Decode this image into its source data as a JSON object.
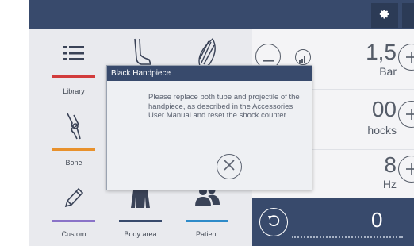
{
  "header": {
    "settings_icon": "gear-icon"
  },
  "tiles": {
    "library": {
      "label": "Library",
      "icon": "list-icon",
      "accent": "#d23c3c"
    },
    "bone": {
      "label": "Bone",
      "icon": "knee-joint-icon",
      "accent": "#e8912c"
    },
    "custom": {
      "label": "Custom",
      "icon": "pencil-icon",
      "accent": "#8a73c8"
    },
    "body_area": {
      "label": "Body area",
      "icon": "torso-icon",
      "accent": "#384a6c"
    },
    "patient": {
      "label": "Patient",
      "icon": "patients-icon",
      "accent": "#2e8bc9"
    },
    "foot": {
      "icon": "foot-icon"
    },
    "muscle": {
      "icon": "muscle-icon"
    }
  },
  "parameters": {
    "pressure": {
      "value": "1,5",
      "unit": "Bar"
    },
    "shocks": {
      "value": "00",
      "unit": "hocks"
    },
    "frequency": {
      "value": "8",
      "unit": "Hz"
    }
  },
  "counter": {
    "value": "0",
    "icon": "reset-counter-icon"
  },
  "dialog": {
    "title": "Black Handpiece",
    "message": "Please replace both tube and projectile of the handpiece, as described in the Accessories User Manual and reset the shock counter",
    "close_icon": "close-icon"
  }
}
